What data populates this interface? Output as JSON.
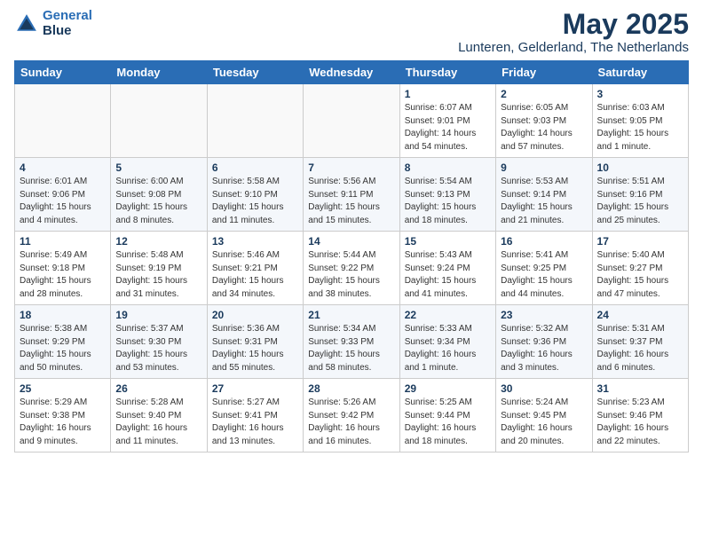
{
  "logo": {
    "line1": "General",
    "line2": "Blue"
  },
  "title": "May 2025",
  "subtitle": "Lunteren, Gelderland, The Netherlands",
  "days_of_week": [
    "Sunday",
    "Monday",
    "Tuesday",
    "Wednesday",
    "Thursday",
    "Friday",
    "Saturday"
  ],
  "weeks": [
    [
      {
        "day": "",
        "info": ""
      },
      {
        "day": "",
        "info": ""
      },
      {
        "day": "",
        "info": ""
      },
      {
        "day": "",
        "info": ""
      },
      {
        "day": "1",
        "info": "Sunrise: 6:07 AM\nSunset: 9:01 PM\nDaylight: 14 hours\nand 54 minutes."
      },
      {
        "day": "2",
        "info": "Sunrise: 6:05 AM\nSunset: 9:03 PM\nDaylight: 14 hours\nand 57 minutes."
      },
      {
        "day": "3",
        "info": "Sunrise: 6:03 AM\nSunset: 9:05 PM\nDaylight: 15 hours\nand 1 minute."
      }
    ],
    [
      {
        "day": "4",
        "info": "Sunrise: 6:01 AM\nSunset: 9:06 PM\nDaylight: 15 hours\nand 4 minutes."
      },
      {
        "day": "5",
        "info": "Sunrise: 6:00 AM\nSunset: 9:08 PM\nDaylight: 15 hours\nand 8 minutes."
      },
      {
        "day": "6",
        "info": "Sunrise: 5:58 AM\nSunset: 9:10 PM\nDaylight: 15 hours\nand 11 minutes."
      },
      {
        "day": "7",
        "info": "Sunrise: 5:56 AM\nSunset: 9:11 PM\nDaylight: 15 hours\nand 15 minutes."
      },
      {
        "day": "8",
        "info": "Sunrise: 5:54 AM\nSunset: 9:13 PM\nDaylight: 15 hours\nand 18 minutes."
      },
      {
        "day": "9",
        "info": "Sunrise: 5:53 AM\nSunset: 9:14 PM\nDaylight: 15 hours\nand 21 minutes."
      },
      {
        "day": "10",
        "info": "Sunrise: 5:51 AM\nSunset: 9:16 PM\nDaylight: 15 hours\nand 25 minutes."
      }
    ],
    [
      {
        "day": "11",
        "info": "Sunrise: 5:49 AM\nSunset: 9:18 PM\nDaylight: 15 hours\nand 28 minutes."
      },
      {
        "day": "12",
        "info": "Sunrise: 5:48 AM\nSunset: 9:19 PM\nDaylight: 15 hours\nand 31 minutes."
      },
      {
        "day": "13",
        "info": "Sunrise: 5:46 AM\nSunset: 9:21 PM\nDaylight: 15 hours\nand 34 minutes."
      },
      {
        "day": "14",
        "info": "Sunrise: 5:44 AM\nSunset: 9:22 PM\nDaylight: 15 hours\nand 38 minutes."
      },
      {
        "day": "15",
        "info": "Sunrise: 5:43 AM\nSunset: 9:24 PM\nDaylight: 15 hours\nand 41 minutes."
      },
      {
        "day": "16",
        "info": "Sunrise: 5:41 AM\nSunset: 9:25 PM\nDaylight: 15 hours\nand 44 minutes."
      },
      {
        "day": "17",
        "info": "Sunrise: 5:40 AM\nSunset: 9:27 PM\nDaylight: 15 hours\nand 47 minutes."
      }
    ],
    [
      {
        "day": "18",
        "info": "Sunrise: 5:38 AM\nSunset: 9:29 PM\nDaylight: 15 hours\nand 50 minutes."
      },
      {
        "day": "19",
        "info": "Sunrise: 5:37 AM\nSunset: 9:30 PM\nDaylight: 15 hours\nand 53 minutes."
      },
      {
        "day": "20",
        "info": "Sunrise: 5:36 AM\nSunset: 9:31 PM\nDaylight: 15 hours\nand 55 minutes."
      },
      {
        "day": "21",
        "info": "Sunrise: 5:34 AM\nSunset: 9:33 PM\nDaylight: 15 hours\nand 58 minutes."
      },
      {
        "day": "22",
        "info": "Sunrise: 5:33 AM\nSunset: 9:34 PM\nDaylight: 16 hours\nand 1 minute."
      },
      {
        "day": "23",
        "info": "Sunrise: 5:32 AM\nSunset: 9:36 PM\nDaylight: 16 hours\nand 3 minutes."
      },
      {
        "day": "24",
        "info": "Sunrise: 5:31 AM\nSunset: 9:37 PM\nDaylight: 16 hours\nand 6 minutes."
      }
    ],
    [
      {
        "day": "25",
        "info": "Sunrise: 5:29 AM\nSunset: 9:38 PM\nDaylight: 16 hours\nand 9 minutes."
      },
      {
        "day": "26",
        "info": "Sunrise: 5:28 AM\nSunset: 9:40 PM\nDaylight: 16 hours\nand 11 minutes."
      },
      {
        "day": "27",
        "info": "Sunrise: 5:27 AM\nSunset: 9:41 PM\nDaylight: 16 hours\nand 13 minutes."
      },
      {
        "day": "28",
        "info": "Sunrise: 5:26 AM\nSunset: 9:42 PM\nDaylight: 16 hours\nand 16 minutes."
      },
      {
        "day": "29",
        "info": "Sunrise: 5:25 AM\nSunset: 9:44 PM\nDaylight: 16 hours\nand 18 minutes."
      },
      {
        "day": "30",
        "info": "Sunrise: 5:24 AM\nSunset: 9:45 PM\nDaylight: 16 hours\nand 20 minutes."
      },
      {
        "day": "31",
        "info": "Sunrise: 5:23 AM\nSunset: 9:46 PM\nDaylight: 16 hours\nand 22 minutes."
      }
    ]
  ]
}
